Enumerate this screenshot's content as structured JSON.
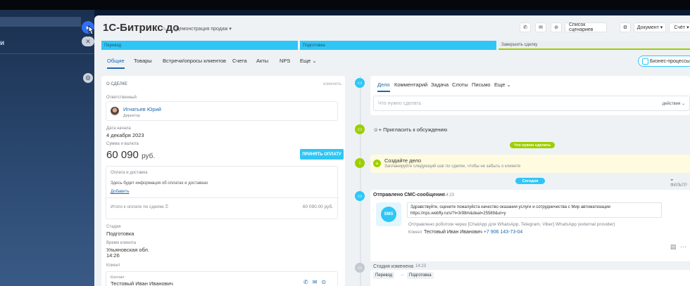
{
  "bg": {
    "sidebar_title": "и"
  },
  "header": {
    "title": "1С-Битрикс до",
    "category": "Демонстрация продаж",
    "btn_scenarios": "Список сценариев",
    "btn_document": "Документ",
    "btn_invoice": "Счёт"
  },
  "stages": [
    "Перевод",
    "Подготовка",
    "Завершить сделку"
  ],
  "tabs": [
    "Общие",
    "Товары",
    "Встречи/опросы клиентов",
    "Счета",
    "Акты",
    "NPS",
    "Еще"
  ],
  "bp_button": "Бизнес-процессы",
  "card": {
    "section_title": "о сделке",
    "edit": "изменить",
    "responsible_label": "Ответственный",
    "responsible_name": "Игнатьев Юрий",
    "responsible_role": "Директор",
    "start_label": "Дата начала",
    "start_value": "4 декабря 2023",
    "sum_label": "Сумма и валюта",
    "sum_value": "60 090",
    "sum_currency": "руб.",
    "accept_button": "ПРИНЯТЬ ОПЛАТУ",
    "pay_title": "Оплата и доставка",
    "pay_hint": "Здесь будет информация об оплатах и доставках",
    "pay_add": "Добавить",
    "total_label": "Итого к оплате по сделке",
    "total_value": "60 090.00 руб.",
    "stage_label": "Стадия",
    "stage_value": "Подготовка",
    "time_label": "Время клиента",
    "time_region": "Ульяновская обл.",
    "time_value": "14:26",
    "client_label": "Клиент",
    "contact_label": "Контакт",
    "contact_name": "Тестовый Иван Иванович"
  },
  "editor": {
    "tabs": [
      "Дело",
      "Комментарий",
      "Задача",
      "Слоты",
      "Письмо",
      "Еще"
    ],
    "placeholder": "Что нужно сделать",
    "actions": "действия"
  },
  "timeline": {
    "invite": "Пригласить к обсуждению",
    "todo_badge": "Что нужно сделать",
    "todo_title": "Создайте дело",
    "todo_hint": "Запланируйте следующий шаг по сделке, чтобы не забыть о клиенте",
    "today_badge": "Сегодня",
    "filter": "ФИЛЬТР",
    "sms_title": "Отправлено СМС-сообщение",
    "sms_time": "14:23",
    "sms_logo": "SMS",
    "sms_text1": "Здравствуйте, оцените пожалуйста качество оказания услуги и сотрудничества с Мир автоматизации",
    "sms_text2": "https://nps.webfly.ru/s/?i=3r98m&deal=25589&ut=y",
    "sms_via": "Отправлено роботом через [ChatApp для WhatsApp, Telegram, Viber] WhatsApp (external provider)",
    "sms_client_label": "Клиент",
    "sms_client": "Тестовый Иван Иванович",
    "sms_phone": "+7 906 143-73-04",
    "stage_changed": "Стадия изменена",
    "stage_time": "14:23",
    "stage_from": "Перевод",
    "stage_to": "Подготовка"
  }
}
